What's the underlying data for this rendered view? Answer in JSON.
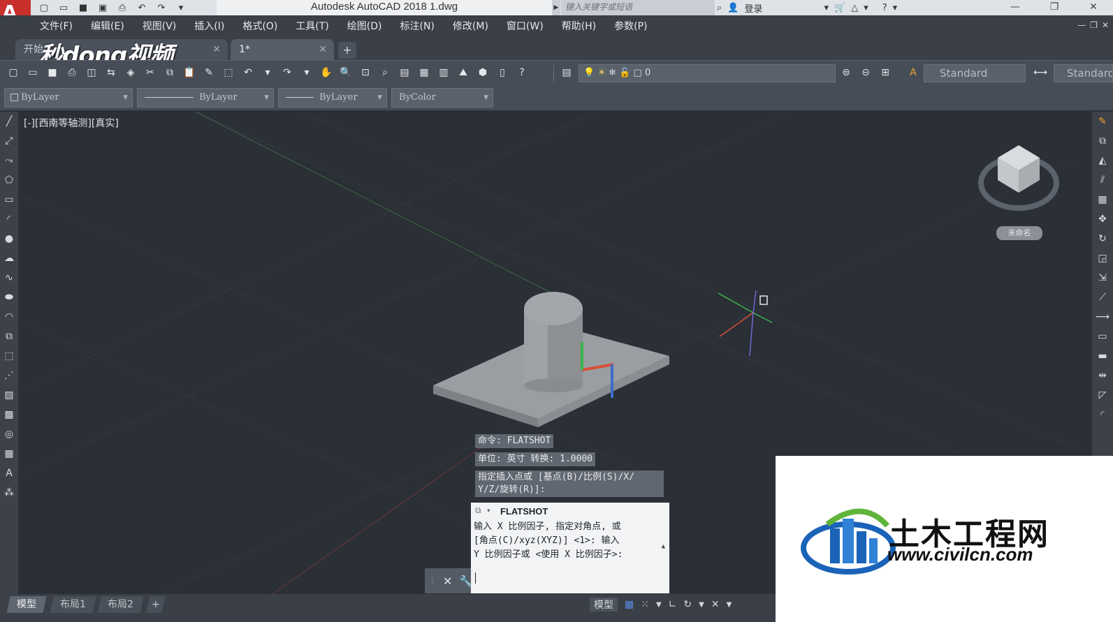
{
  "app": {
    "logo_letter": "A",
    "title": "Autodesk AutoCAD 2018    1.dwg",
    "search_placeholder": "键入关键字或短语",
    "login": "登录",
    "qat_icons": [
      "new-icon",
      "open-icon",
      "save-icon",
      "saveas-icon",
      "print-icon",
      "undo-icon",
      "redo-icon",
      "dropdown-icon"
    ]
  },
  "menu": {
    "items": [
      "文件(F)",
      "编辑(E)",
      "视图(V)",
      "插入(I)",
      "格式(O)",
      "工具(T)",
      "绘图(D)",
      "标注(N)",
      "修改(M)",
      "窗口(W)",
      "帮助(H)",
      "参数(P)"
    ]
  },
  "tabs": {
    "start_label": "开始",
    "doc_label": "1*",
    "add_label": "+",
    "watermark": "秒dong视频"
  },
  "toolbar": {
    "layer_value": "0",
    "text_style": "Standard",
    "dim_style": "Standard"
  },
  "properties": {
    "color": "ByLayer",
    "linetype": "ByLayer",
    "lineweight": "ByLayer",
    "plotstyle": "ByColor"
  },
  "viewport": {
    "label": "[-][西南等轴测][真实]",
    "wcs": "未命名"
  },
  "command": {
    "hist1": "命令: FLATSHOT",
    "hist2": "单位: 英寸   转换:    1.0000",
    "hist3a": "指定插入点或 [基点(B)/比例(S)/X/",
    "hist3b": "Y/Z/旋转(R)]:",
    "panel_title": "FLATSHOT",
    "panel_body": "输入 X 比例因子, 指定对角点, 或\n[角点(C)/xyz(XYZ)] <1>:  输入\nY 比例因子或 <使用 X 比例因子>:"
  },
  "layouts": {
    "model": "模型",
    "layout1": "布局1",
    "layout2": "布局2",
    "add": "+"
  },
  "status": {
    "model": "模型"
  },
  "overlay": {
    "cn": "土木工程网",
    "url": "www.civilcn.com"
  },
  "colors": {
    "accent_red": "#c9302c",
    "viewport_bg": "#2b2f36",
    "model_gray": "#9a9ea3"
  }
}
